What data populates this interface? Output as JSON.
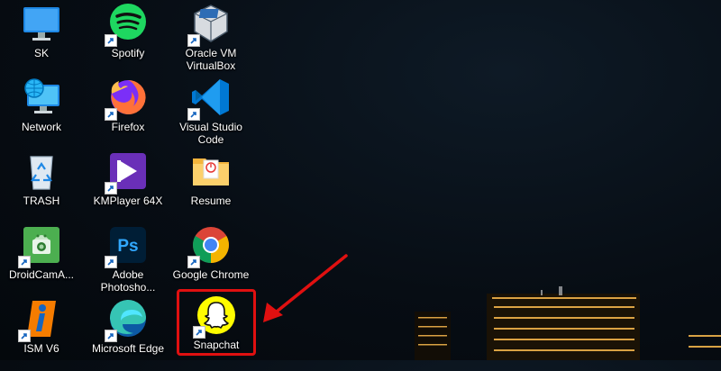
{
  "desktop": {
    "icons": [
      {
        "label": "SK",
        "icon": "monitor-icon"
      },
      {
        "label": "Spotify",
        "icon": "spotify-icon"
      },
      {
        "label": "Oracle VM VirtualBox",
        "icon": "virtualbox-icon"
      },
      {
        "label": "Network",
        "icon": "network-icon"
      },
      {
        "label": "Firefox",
        "icon": "firefox-icon"
      },
      {
        "label": "Visual Studio Code",
        "icon": "vscode-icon"
      },
      {
        "label": "TRASH",
        "icon": "recycle-bin-icon"
      },
      {
        "label": "KMPlayer 64X",
        "icon": "kmplayer-icon"
      },
      {
        "label": "Resume",
        "icon": "folder-icon"
      },
      {
        "label": "DroidCamA...",
        "icon": "droidcam-icon"
      },
      {
        "label": "Adobe Photosho...",
        "icon": "photoshop-icon"
      },
      {
        "label": "Google Chrome",
        "icon": "chrome-icon"
      },
      {
        "label": "ISM V6",
        "icon": "ism-icon"
      },
      {
        "label": "Microsoft Edge",
        "icon": "edge-icon"
      },
      {
        "label": "Snapchat",
        "icon": "snapchat-icon"
      }
    ]
  },
  "colors": {
    "highlight": "#e01010",
    "snapchat": "#fffc00",
    "spotify": "#1ed760"
  }
}
